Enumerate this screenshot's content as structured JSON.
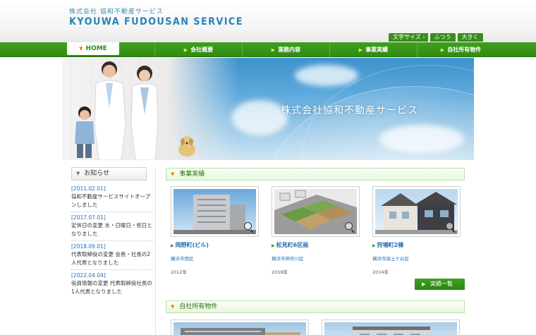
{
  "header": {
    "logo_sub": "株式会社 協和不動産サービス",
    "logo_main": "KYOUWA FUDOUSAN SERVICE",
    "font_size_label": "文字サイズ",
    "font_size_normal": "ふつう",
    "font_size_large": "大きく"
  },
  "nav": {
    "home": "HOME",
    "items": [
      "会社概要",
      "業務内容",
      "事業実績",
      "自社所有物件"
    ]
  },
  "hero": {
    "title": "株式会社協和不動産サービス"
  },
  "sidebar": {
    "title": "お知らせ",
    "news": [
      {
        "date": "[2011.02.01]",
        "text": "協和不動産サービスサイトオープンしました"
      },
      {
        "date": "[2017.07.01]",
        "text": "定休日の変更 水・日曜日・祝日となりました"
      },
      {
        "date": "[2018.09.01]",
        "text": "代表取締役の変更 会長・社長の2人代表となりました"
      },
      {
        "date": "[2022.04.04]",
        "text": "役員情報の変更 代表取締役社長の1人代表となりました"
      }
    ]
  },
  "main": {
    "works_title": "事業実績",
    "works": [
      {
        "title": "岡野町(ビル)",
        "area": "横浜市西区",
        "year": "2012年"
      },
      {
        "title": "松見町6区画",
        "area": "横浜市神奈川区",
        "year": "2019年"
      },
      {
        "title": "狩場町2棟",
        "area": "横浜市保土ケ谷区",
        "year": "2014年"
      }
    ],
    "more_label": "実績一覧",
    "owned_title": "自社所有物件"
  },
  "colors": {
    "nav_green": "#2f8b12",
    "link_blue": "#2070b8",
    "accent_orange": "#e08a00"
  }
}
